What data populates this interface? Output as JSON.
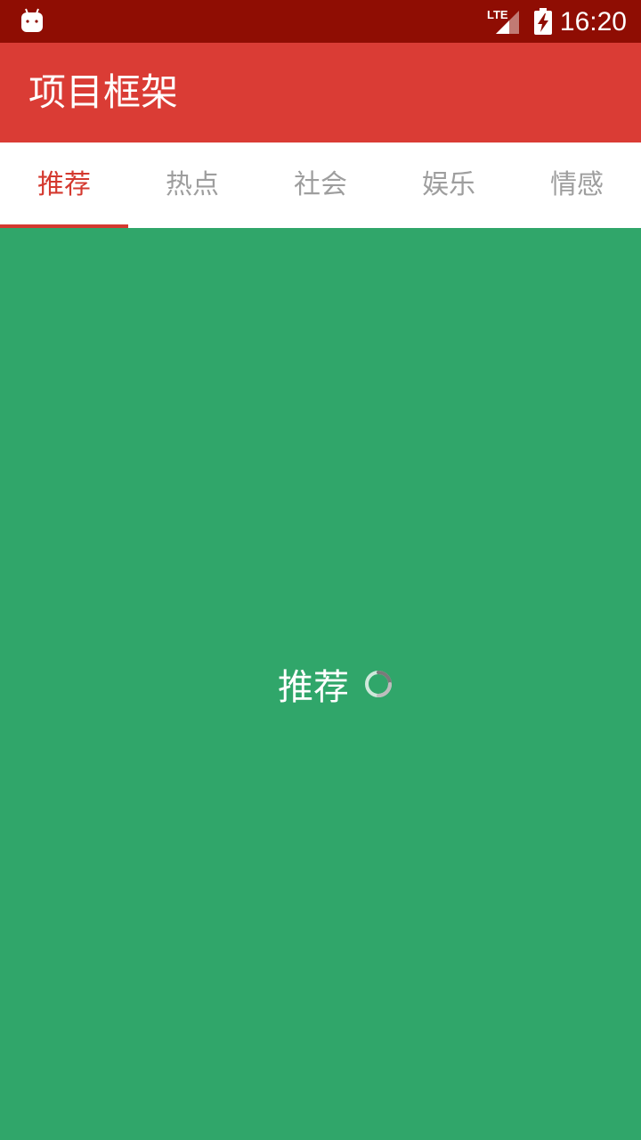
{
  "status_bar": {
    "time": "16:20",
    "network_label": "LTE",
    "icons": [
      "android-icon",
      "lte-signal-icon",
      "battery-charging-icon"
    ]
  },
  "app_bar": {
    "title": "项目框架",
    "background_color": "#da3c35"
  },
  "tabs": [
    {
      "label": "推荐",
      "selected": true
    },
    {
      "label": "热点",
      "selected": false
    },
    {
      "label": "社会",
      "selected": false
    },
    {
      "label": "娱乐",
      "selected": false
    },
    {
      "label": "情感",
      "selected": false
    }
  ],
  "content": {
    "loading_text": "推荐",
    "background_color": "#30a66a",
    "loading_icon": "spinner-icon"
  },
  "colors": {
    "status_bar": "#8f0d03",
    "accent": "#d4392f",
    "tab_inactive": "#9e9e9e"
  }
}
